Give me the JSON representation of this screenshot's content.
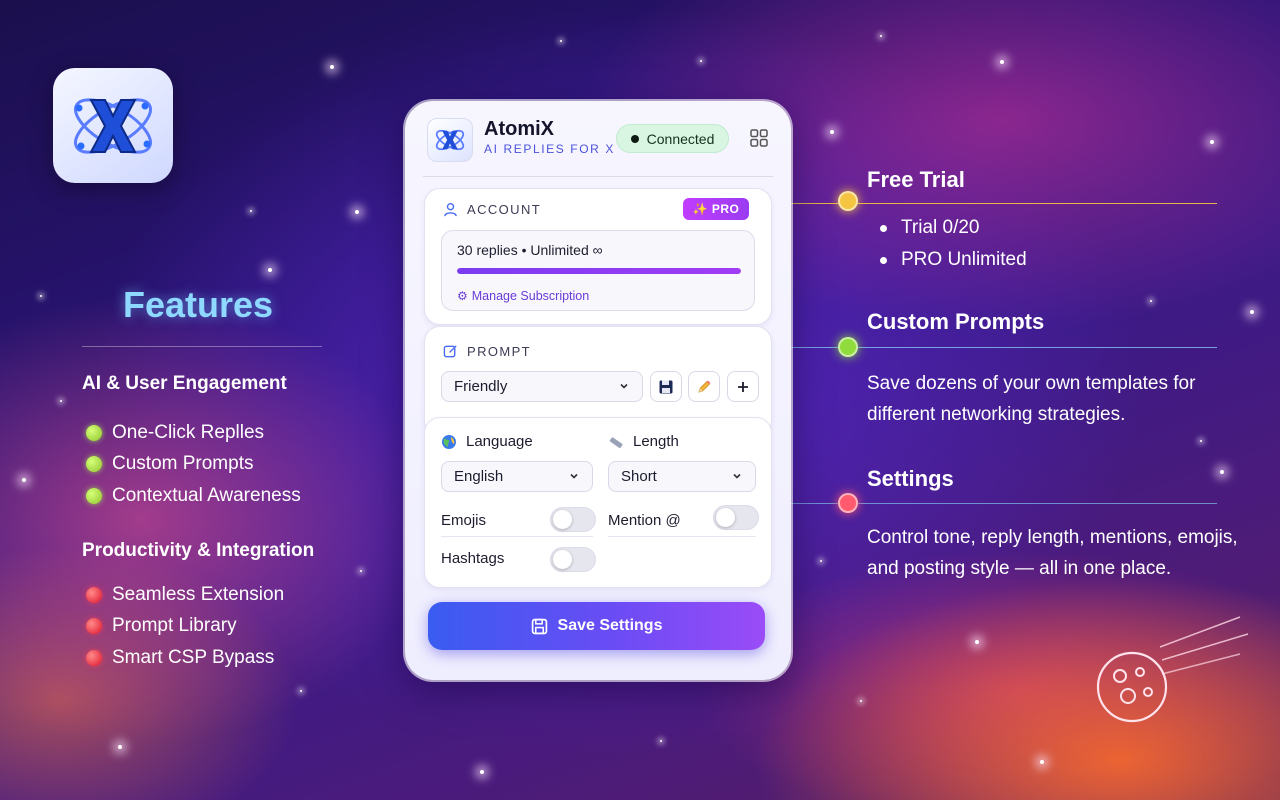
{
  "features": {
    "title": "Features",
    "sections": [
      {
        "heading": "AI & User Engagement",
        "dot_color": "#a9e34b",
        "items": [
          "One-Click Replles",
          "Custom Prompts",
          "Contextual Awareness"
        ]
      },
      {
        "heading": "Productivity & Integration",
        "dot_color": "#ff2a3a",
        "items": [
          "Seamless Extension",
          "Prompt Library",
          "Smart CSP Bypass"
        ]
      }
    ]
  },
  "panel": {
    "brand": {
      "name": "AtomiX",
      "subtitle": "AI REPLIES FOR X"
    },
    "status": "Connected",
    "account": {
      "label": "ACCOUNT",
      "badge": "✨ PRO",
      "usage_text": "30 replies • Unlimited ∞",
      "usage_progress": 1.0,
      "manage_link": "Manage Subscription"
    },
    "prompt": {
      "label": "PROMPT",
      "selected": "Friendly"
    },
    "settings": {
      "language_label": "Language",
      "language_value": "English",
      "length_label": "Length",
      "length_value": "Short",
      "emojis_label": "Emojis",
      "emojis_on": false,
      "mention_label": "Mention @",
      "mention_on": false,
      "hashtags_label": "Hashtags",
      "hashtags_on": false
    },
    "save_label": "Save Settings"
  },
  "callouts": {
    "free_trial": {
      "title": "Free Trial",
      "color": "#f5c542",
      "bullets": [
        "Trial 0/20",
        "PRO Unlimited"
      ]
    },
    "custom_prompts": {
      "title": "Custom Prompts",
      "color": "#8fdc3c",
      "text": "Save dozens of your own templates for different networking strategies."
    },
    "settings": {
      "title": "Settings",
      "color": "#ff5a6e",
      "text": "Control tone, reply length, mentions, emojis, and posting style — all in one place."
    }
  }
}
